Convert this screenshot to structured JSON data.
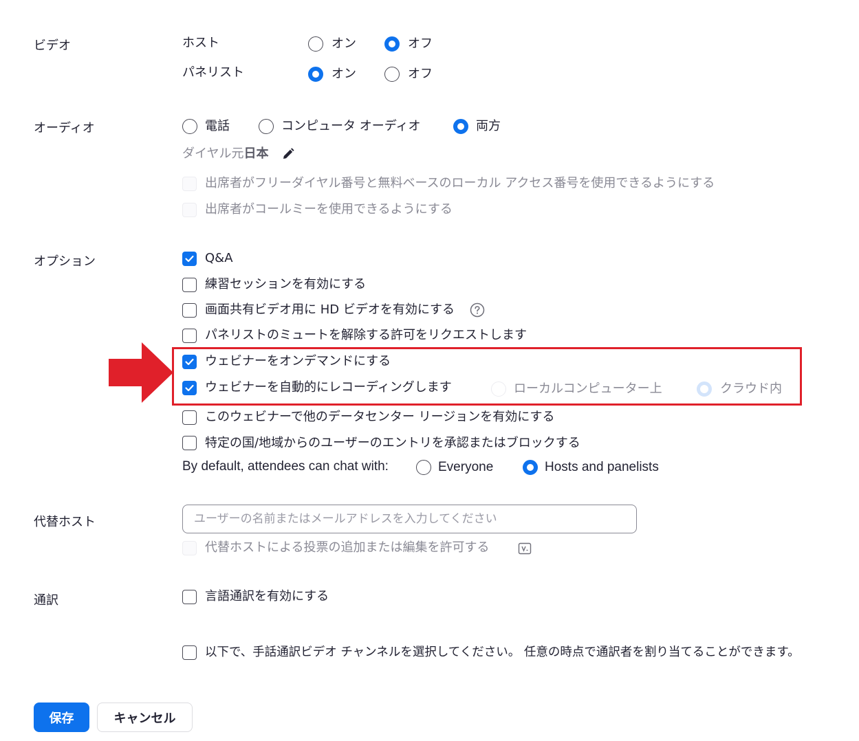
{
  "video": {
    "label": "ビデオ",
    "host": {
      "label": "ホスト",
      "on": "オン",
      "off": "オフ",
      "selected": "off"
    },
    "panelist": {
      "label": "パネリスト",
      "on": "オン",
      "off": "オフ",
      "selected": "on"
    }
  },
  "audio": {
    "label": "オーディオ",
    "options": [
      "電話",
      "コンピュータ オーディオ",
      "両方"
    ],
    "selected": "両方",
    "dial_from_prefix": "ダイヤル元",
    "dial_from_country": "日本",
    "toll_free_label": "出席者がフリーダイヤル番号と無料ベースのローカル アクセス番号を使用できるようにする",
    "call_me_label": "出席者がコールミーを使用できるようにする"
  },
  "options": {
    "label": "オプション",
    "qa": "Q&A",
    "practice": "練習セッションを有効にする",
    "hd_video": "画面共有ビデオ用に HD ビデオを有効にする",
    "unmute": "パネリストのミュートを解除する許可をリクエストします",
    "on_demand": "ウェビナーをオンデマンドにする",
    "auto_record": "ウェビナーを自動的にレコーディングします",
    "record_local": "ローカルコンピューター上",
    "record_cloud": "クラウド内",
    "data_center": "このウェビナーで他のデータセンター リージョンを有効にする",
    "country_block": "特定の国/地域からのユーザーのエントリを承認またはブロックする",
    "chat_default_label": "By default, attendees can chat with:",
    "chat_everyone": "Everyone",
    "chat_hosts": "Hosts and panelists"
  },
  "alt_host": {
    "label": "代替ホスト",
    "placeholder": "ユーザーの名前またはメールアドレスを入力してください",
    "poll_edit": "代替ホストによる投票の追加または編集を許可する"
  },
  "interpretation": {
    "label": "通訳",
    "language": "言語通訳を有効にする",
    "sign_language": "以下で、手話通訳ビデオ チャンネルを選択してください。 任意の時点で通訳者を割り当てることができます。"
  },
  "buttons": {
    "save": "保存",
    "cancel": "キャンセル"
  },
  "colors": {
    "accent": "#0e72ed",
    "highlight": "#e0202a"
  },
  "icons": [
    "pencil-icon",
    "help-icon",
    "poll-icon",
    "checkmark-icon",
    "red-arrow"
  ]
}
